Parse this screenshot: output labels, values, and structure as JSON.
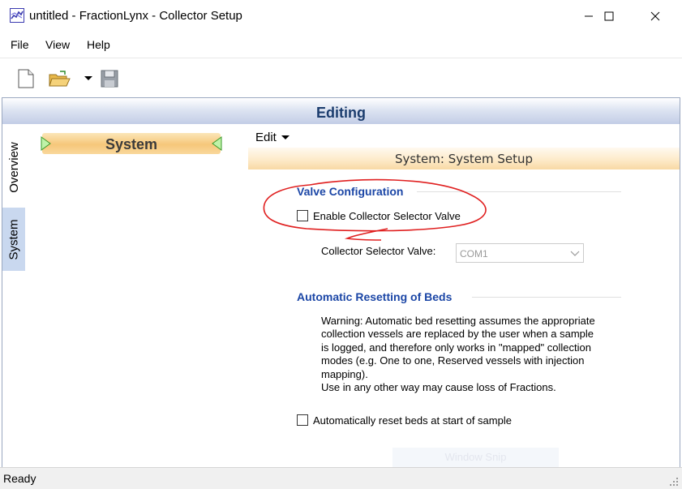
{
  "window": {
    "title": "untitled - FractionLynx - Collector Setup",
    "icons": {
      "app": "fractionlynx-app-icon",
      "minimize": "minimize-icon",
      "maximize": "maximize-icon",
      "close": "close-icon"
    }
  },
  "menu": {
    "items": [
      "File",
      "View",
      "Help"
    ]
  },
  "toolbar": {
    "icons": [
      "new-document-icon",
      "open-folder-icon",
      "dropdown-arrow-icon",
      "save-disk-icon"
    ]
  },
  "editing": {
    "title": "Editing"
  },
  "side_tabs": [
    "Overview",
    "System"
  ],
  "nav": {
    "system_label": "System"
  },
  "content": {
    "edit_menu": "Edit",
    "section_title": "System: System Setup",
    "valve_group": {
      "title": "Valve Configuration",
      "enable_label": "Enable Collector Selector Valve",
      "enable_checked": false,
      "selector_label": "Collector Selector Valve:",
      "selector_value": "COM1"
    },
    "reset_group": {
      "title": "Automatic Resetting of Beds",
      "warning_lines": [
        "Warning: Automatic bed resetting assumes the appropriate",
        "collection vessels are replaced by the user when a sample",
        "is logged, and therefore only works in \"mapped\" collection",
        "modes (e.g. One to one, Reserved vessels with injection",
        "mapping).",
        "Use in any other way may cause loss of Fractions."
      ],
      "auto_reset_label": "Automatically reset beds at start of sample",
      "auto_reset_checked": false
    },
    "ghost_button": "Window Snip"
  },
  "status": {
    "text": "Ready"
  },
  "colors": {
    "accent_blue": "#1b46a6",
    "annotation_red": "#e02020",
    "header_orange": "#f6c77a"
  }
}
